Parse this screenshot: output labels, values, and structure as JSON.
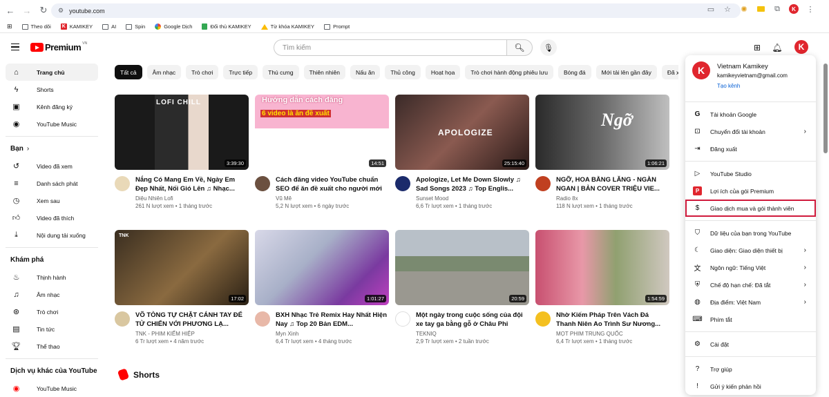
{
  "browser": {
    "url": "youtube.com",
    "bookmarks": [
      "Theo dõi",
      "KAMIKEY",
      "AI",
      "Spin",
      "Google Dịch",
      "Đối thủ KAMIKEY",
      "Từ khóa KAMIKEY",
      "Prompt"
    ]
  },
  "header": {
    "logo_text": "Premium",
    "logo_region": "VN",
    "search_placeholder": "Tìm kiếm",
    "avatar_letter": "K"
  },
  "sidebar": {
    "main": [
      "Trang chủ",
      "Shorts",
      "Kênh đăng ký",
      "YouTube Music"
    ],
    "you_heading": "Bạn",
    "you_items": [
      "Video đã xem",
      "Danh sách phát",
      "Xem sau",
      "Video đã thích",
      "Nội dung tải xuống"
    ],
    "explore_heading": "Khám phá",
    "explore_items": [
      "Thịnh hành",
      "Âm nhạc",
      "Trò chơi",
      "Tin tức",
      "Thể thao"
    ],
    "more_heading": "Dịch vụ khác của YouTube",
    "more_items": [
      "YouTube Music"
    ]
  },
  "chips": [
    "Tất cả",
    "Âm nhạc",
    "Trò chơi",
    "Trực tiếp",
    "Thú cưng",
    "Thiên nhiên",
    "Nấu ăn",
    "Thủ công",
    "Hoạt họa",
    "Trò chơi hành động phiêu lưu",
    "Bóng đá",
    "Mới tải lên gần đây",
    "Đã xe"
  ],
  "videos": [
    {
      "title": "Nắng Có Mang Em Về, Ngày Em Đẹp Nhất, Nối Gió Lên ♫ Nhạc...",
      "channel": "Diệu Nhiên Lofi",
      "stats": "261 N lượt xem • 1 tháng trước",
      "duration": "3:39:30",
      "thumb_text": "LOFI CHILL"
    },
    {
      "title": "Cách đăng video YouTube chuẩn SEO để ăn đề xuất cho người mới",
      "channel": "Vũ Mê",
      "stats": "5,2 N lượt xem • 6 ngày trước",
      "duration": "14:51",
      "thumb_text": "Hướng dẫn cách đăng",
      "thumb_text2": "6 video là ăn đề xuất"
    },
    {
      "title": "Apologize, Let Me Down Slowly ♫ Sad Songs 2023 ♫ Top Englis...",
      "channel": "Sunset Mood",
      "stats": "6,6 Tr lượt xem • 1 tháng trước",
      "duration": "25:15:40",
      "thumb_text": "APOLOGIZE"
    },
    {
      "title": "NGỠ, HOA BẰNG LĂNG - NGÀN NGAN | BẢN COVER TRIỆU VIE...",
      "channel": "Radio 8x",
      "stats": "118 N lượt xem • 1 tháng trước",
      "duration": "1:06:21",
      "thumb_text": "Ngỡ"
    },
    {
      "title": "VÕ TÒNG TỰ CHẶT CÁNH TAY ĐỂ TỬ CHIẾN VỚI PHƯƠNG LẠ...",
      "channel": "TNK - PHIM KIẾM HIỆP",
      "stats": "6 Tr lượt xem • 4 năm trước",
      "duration": "17:02",
      "thumb_text": "TNK"
    },
    {
      "title": "BXH Nhạc Trẻ Remix Hay Nhất Hiện Nay ♫ Top 20 Bản EDM...",
      "channel": "Myn Xinh",
      "stats": "6,4 Tr lượt xem • 4 tháng trước",
      "duration": "1:01:27",
      "thumb_text": ""
    },
    {
      "title": "Một ngày trong cuộc sống của đội xe tay ga bằng gỗ ở Châu Phi",
      "channel": "TEKNIQ",
      "stats": "2,9 Tr lượt xem • 2 tuần trước",
      "duration": "20:59",
      "thumb_text": ""
    },
    {
      "title": "Nhờ Kiếm Pháp Trên Vách Đá Thanh Niên Ao Trình Sư Nương...",
      "channel": "MỌT PHIM TRUNG QUỐC",
      "stats": "6,4 Tr lượt xem • 1 tháng trước",
      "duration": "1:54:59",
      "thumb_text": ""
    }
  ],
  "shorts_label": "Shorts",
  "account_menu": {
    "name": "Vietnam Kamikey",
    "email": "kamikeyvietnam@gmail.com",
    "create_channel": "Tạo kênh",
    "group1": [
      "Tài khoản Google",
      "Chuyển đổi tài khoản",
      "Đăng xuất"
    ],
    "group2": [
      "YouTube Studio",
      "Lợi ích của gói Premium",
      "Giao dịch mua và gói thành viên"
    ],
    "group3": [
      "Dữ liệu của bạn trong YouTube",
      "Giao diện: Giao diện thiết bị",
      "Ngôn ngữ: Tiếng Việt",
      "Chế độ hạn chế: Đã tắt",
      "Địa điểm: Việt Nam",
      "Phím tắt"
    ],
    "group4": [
      "Cài đặt"
    ],
    "group5": [
      "Trợ giúp",
      "Gửi ý kiến phản hồi"
    ]
  },
  "colors": {
    "brand_red": "#ff0000",
    "accent_blue": "#065fd4",
    "highlight": "#d0193b"
  }
}
